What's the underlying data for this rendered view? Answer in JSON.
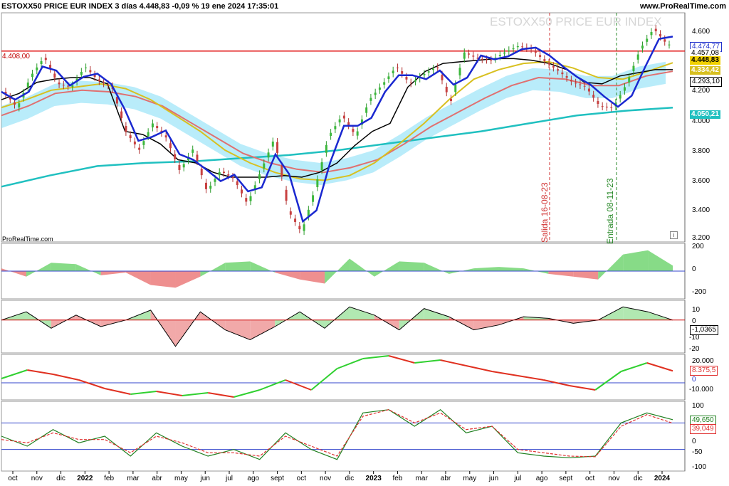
{
  "header": {
    "title": "ESTOXX50 PRICE EUR INDEX 3 días 4.448,83 -0,09 % 19 ene 2024 17:35:01",
    "site": "www.ProRealTime.com",
    "watermark": "ESTOXX50 PRICE EUR INDEX",
    "source": "ProRealTime.com",
    "info_icon": "i"
  },
  "chart_data": {
    "type": "line",
    "x": [
      "oct",
      "nov",
      "dic",
      "2022",
      "feb",
      "mar",
      "abr",
      "may",
      "jun",
      "jul",
      "ago",
      "sept",
      "oct",
      "nov",
      "dic",
      "2023",
      "feb",
      "mar",
      "abr",
      "may",
      "jun",
      "jul",
      "ago",
      "sept",
      "oct",
      "nov",
      "dic",
      "2024"
    ],
    "panels": [
      {
        "name": "price",
        "ylim": [
          3200,
          4650
        ],
        "y_ticks": [
          "4.600",
          "4.200",
          "4.000",
          "3.800",
          "3.600",
          "3.400",
          "3.200"
        ],
        "series": [
          {
            "role": "close",
            "color": "#2a9a2a",
            "values": [
              4150,
              4050,
              4250,
              4370,
              4200,
              4180,
              4310,
              4220,
              4180,
              3900,
              3780,
              3950,
              3860,
              3650,
              3790,
              3520,
              3650,
              3600,
              3440,
              3650,
              3860,
              3400,
              3260,
              3540,
              3870,
              4000,
              3870,
              4100,
              4200,
              4310,
              4200,
              4260,
              4310,
              4080,
              4400,
              4360,
              4350,
              4400,
              4440,
              4420,
              4340,
              4280,
              4210,
              4180,
              4060,
              4050,
              4200,
              4420,
              4550,
              4449
            ]
          },
          {
            "role": "kijun",
            "color": "#000000",
            "values": [
              4100,
              4140,
              4210,
              4230,
              4240,
              4240,
              4200,
              3900,
              3880,
              3820,
              3720,
              3700,
              3640,
              3610,
              3610,
              3610,
              3620,
              3610,
              3640,
              3700,
              3810,
              3900,
              3950,
              4180,
              4280,
              4330,
              4340,
              4350,
              4360,
              4360,
              4350,
              4330,
              4290,
              4210,
              4200,
              4250,
              4270,
              4290,
              4290
            ]
          },
          {
            "role": "sma_slow",
            "color": "#d8c020",
            "values": [
              4050,
              4100,
              4160,
              4180,
              4200,
              4170,
              4100,
              4000,
              3900,
              3780,
              3700,
              3640,
              3600,
              3590,
              3620,
              3700,
              3820,
              3950,
              4100,
              4230,
              4290,
              4330,
              4340,
              4300,
              4240,
              4230,
              4280,
              4334
            ]
          },
          {
            "role": "sma_mid",
            "color": "#e07070",
            "values": [
              4000,
              4060,
              4140,
              4160,
              4150,
              4120,
              4060,
              3960,
              3860,
              3760,
              3700,
              3660,
              3640,
              3670,
              3720,
              3820,
              3930,
              4020,
              4110,
              4190,
              4240,
              4230,
              4190,
              4190,
              4250,
              4280
            ]
          },
          {
            "role": "sma_long",
            "color": "#20c0c0",
            "values": [
              3550,
              3620,
              3680,
              3700,
              3710,
              3730,
              3750,
              3780,
              3820,
              3860,
              3900,
              3950,
              4000,
              4030,
              4050
            ]
          }
        ],
        "price_labels": [
          {
            "value": "4.474,77"
          },
          {
            "value": "4.457,08"
          },
          {
            "value": "4.448,83"
          },
          {
            "value": "4.334,42"
          },
          {
            "value": "4.293,10"
          },
          {
            "value": "4.050,21"
          }
        ],
        "hline": {
          "value": 4408,
          "label": "4.408,00"
        },
        "annotations": [
          {
            "text": "Salida 16-08-23",
            "color": "#d03030"
          },
          {
            "text": "Entrada 08-11-23",
            "color": "#2a8a2a"
          }
        ]
      },
      {
        "name": "osc1",
        "ylim": [
          -200,
          200
        ],
        "y_ticks": [
          "200",
          "0",
          "-200"
        ],
        "values": [
          20,
          -40,
          60,
          50,
          -30,
          -10,
          -100,
          -120,
          -40,
          60,
          70,
          -10,
          -60,
          -90,
          90,
          -40,
          70,
          60,
          -20,
          20,
          30,
          20,
          -20,
          -40,
          -60,
          120,
          150,
          40
        ]
      },
      {
        "name": "osc2",
        "ylim": [
          -20,
          12
        ],
        "y_ticks": [
          "10",
          "0",
          "-10",
          "-20"
        ],
        "values": [
          0,
          5,
          -5,
          3,
          -4,
          0,
          6,
          -16,
          5,
          -6,
          -12,
          -4,
          5,
          -5,
          8,
          3,
          -6,
          7,
          2,
          -6,
          -3,
          2,
          1,
          -2,
          0,
          8,
          5,
          0
        ],
        "last": "-1,0365"
      },
      {
        "name": "osc3",
        "ylim": [
          -12000,
          20000
        ],
        "y_ticks": [
          "20.000",
          "0",
          "-10.000"
        ],
        "values": [
          3000,
          9000,
          6000,
          2000,
          -4000,
          -8000,
          -6000,
          -9000,
          -7000,
          -10000,
          -5000,
          2000,
          -5000,
          10000,
          17000,
          19000,
          14000,
          16000,
          12000,
          8000,
          5000,
          2000,
          -2000,
          -5000,
          8000,
          14000,
          8375
        ],
        "last": "8.375,5"
      },
      {
        "name": "osc4",
        "ylim": [
          -105,
          105
        ],
        "y_ticks": [
          "100",
          "0",
          "-50",
          "-100"
        ],
        "series": [
          {
            "color": "#208020",
            "values": [
              0,
              -30,
              20,
              -20,
              0,
              -60,
              10,
              -30,
              -60,
              -40,
              -70,
              10,
              -40,
              -70,
              70,
              80,
              30,
              80,
              10,
              30,
              -50,
              -60,
              -65,
              -60,
              40,
              70,
              49.65
            ]
          },
          {
            "color": "#e03030",
            "values": [
              -10,
              -20,
              10,
              -10,
              -10,
              -50,
              0,
              -20,
              -50,
              -50,
              -60,
              0,
              -30,
              -60,
              60,
              80,
              40,
              70,
              20,
              30,
              -40,
              -50,
              -60,
              -62,
              30,
              65,
              39.049
            ]
          }
        ],
        "last_a": "49,650",
        "last_b": "39,049"
      }
    ]
  }
}
